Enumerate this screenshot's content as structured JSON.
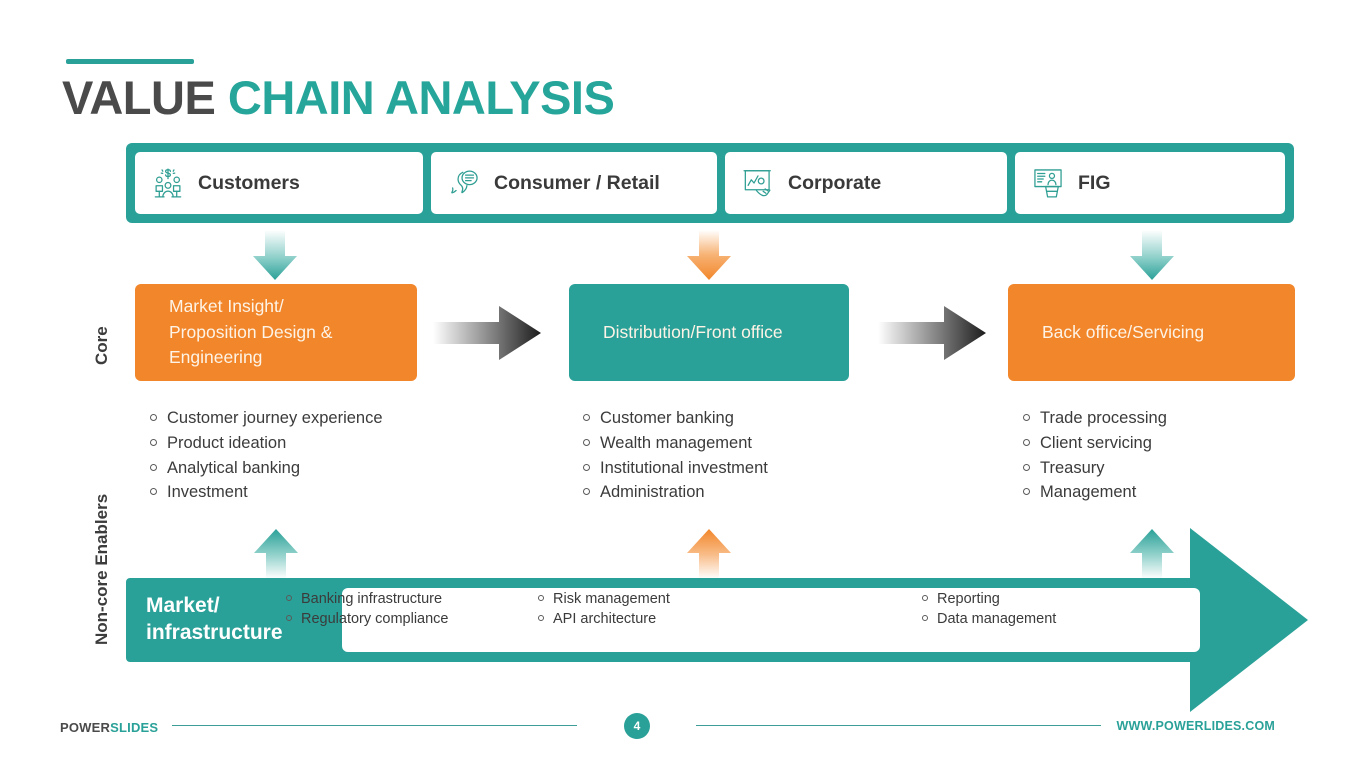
{
  "title": {
    "part1": "VALUE",
    "part2": "CHAIN ANALYSIS"
  },
  "channels": [
    {
      "label": "Customers",
      "icon": "people-money-icon"
    },
    {
      "label": "Consumer / Retail",
      "icon": "speech-bubble-icon"
    },
    {
      "label": "Corporate",
      "icon": "presentation-chart-icon"
    },
    {
      "label": "FIG",
      "icon": "podium-speaker-icon"
    }
  ],
  "row_labels": {
    "core": "Core",
    "non_core": "Non-core Enablers"
  },
  "core_stages": [
    {
      "title": "Market Insight/\nProposition Design &\nEngineering",
      "color": "#f2862a"
    },
    {
      "title": "Distribution/Front office",
      "color": "#2aa198"
    },
    {
      "title": "Back office/Servicing",
      "color": "#f2862a"
    }
  ],
  "core_bullets": [
    [
      "Customer journey experience",
      "Product ideation",
      "Analytical banking",
      "Investment"
    ],
    [
      "Customer banking",
      "Wealth management",
      "Institutional investment",
      "Administration"
    ],
    [
      "Trade processing",
      "Client servicing",
      "Treasury",
      "Management"
    ]
  ],
  "infrastructure": {
    "label": "Market/\ninfrastructure",
    "columns": [
      [
        "Banking infrastructure",
        "Regulatory compliance"
      ],
      [
        "Risk management",
        "API architecture"
      ],
      [
        "Reporting",
        "Data management"
      ]
    ]
  },
  "footer": {
    "brand_part1": "POWER",
    "brand_part2": "SLIDES",
    "page_number": "4",
    "website": "WWW.POWERLIDES.COM"
  },
  "colors": {
    "teal": "#2aa198",
    "orange": "#f2862a",
    "dark": "#4a4a4a"
  }
}
